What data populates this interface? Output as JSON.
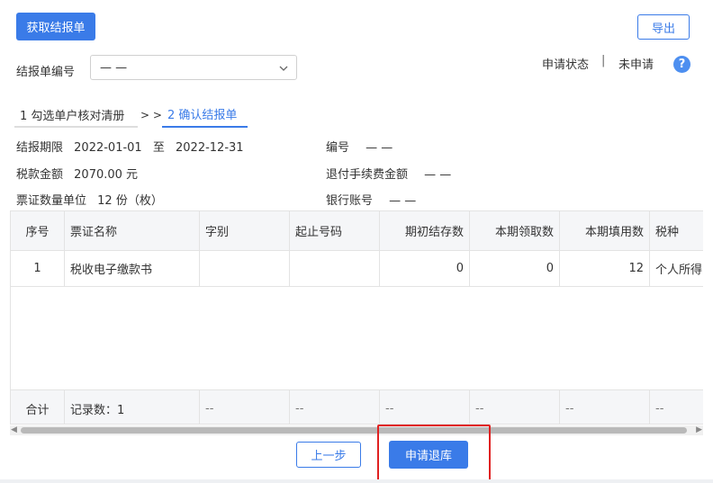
{
  "toolbar": {
    "fetch_label": "获取结报单",
    "export_label": "导出"
  },
  "form": {
    "report_no_label": "结报单编号",
    "report_no_value": "— —"
  },
  "status": {
    "label": "申请状态",
    "separator": "|",
    "value": "未申请",
    "help": "?"
  },
  "steps": {
    "step1": "1 勾选单户核对清册",
    "sep": "> >",
    "step2": "2 确认结报单"
  },
  "info": {
    "period_label": "结报期限",
    "period_start": "2022-01-01",
    "period_to": "至",
    "period_end": "2022-12-31",
    "number_label": "编号",
    "number_value": "— —",
    "tax_label": "税款金额",
    "tax_value": "2070.00 元",
    "refund_fee_label": "退付手续费金额",
    "refund_fee_value": "— —",
    "unit_label": "票证数量单位",
    "unit_value": "12 份（枚）",
    "bank_label": "银行账号",
    "bank_value": "— —"
  },
  "table": {
    "headers": [
      "序号",
      "票证名称",
      "字别",
      "起止号码",
      "期初结存数",
      "本期领取数",
      "本期填用数",
      "税种"
    ],
    "rows": [
      [
        "1",
        "税收电子缴款书",
        "",
        "",
        "0",
        "0",
        "12",
        "个人所得"
      ]
    ],
    "footer": [
      "合计",
      "记录数：1",
      "--",
      "--",
      "--",
      "--",
      "--",
      "--"
    ]
  },
  "actions": {
    "prev_label": "上一步",
    "apply_label": "申请退库"
  },
  "colors": {
    "accent": "#3a7be8",
    "highlight": "#e02020"
  }
}
